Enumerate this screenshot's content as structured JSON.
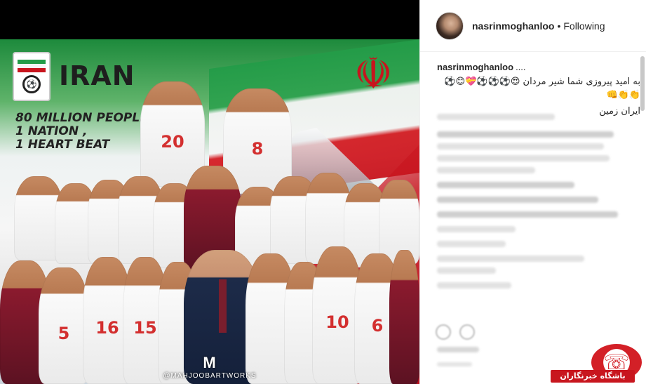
{
  "post": {
    "image": {
      "team_name": "IRAN",
      "slogan": [
        "80 MILLION PEOPLE ,",
        "1 NATION ,",
        "1 HEART BEAT"
      ],
      "jersey_numbers": [
        "20",
        "8",
        "5",
        "16",
        "15",
        "10",
        "6"
      ],
      "watermark_symbol": "M",
      "watermark_text": "@MAHJOOBARTWORKS",
      "colors": {
        "green": "#239c48",
        "red": "#c8141d",
        "white": "#f5f5f5"
      }
    },
    "header": {
      "username": "nasrinmoghanloo",
      "separator": "•",
      "follow_status": "Following"
    },
    "caption": {
      "username": "nasrinmoghanloo",
      "ellipsis": "....",
      "line1": "به امید پیروزی شما شیر مردان 😍⚽⚽⚽💝😊⚽👏👏👊",
      "line2": "ایران زمین"
    },
    "overlay_badge": {
      "label": "باشگاه خبرنگاران",
      "icon": "club-logo-icon"
    }
  }
}
